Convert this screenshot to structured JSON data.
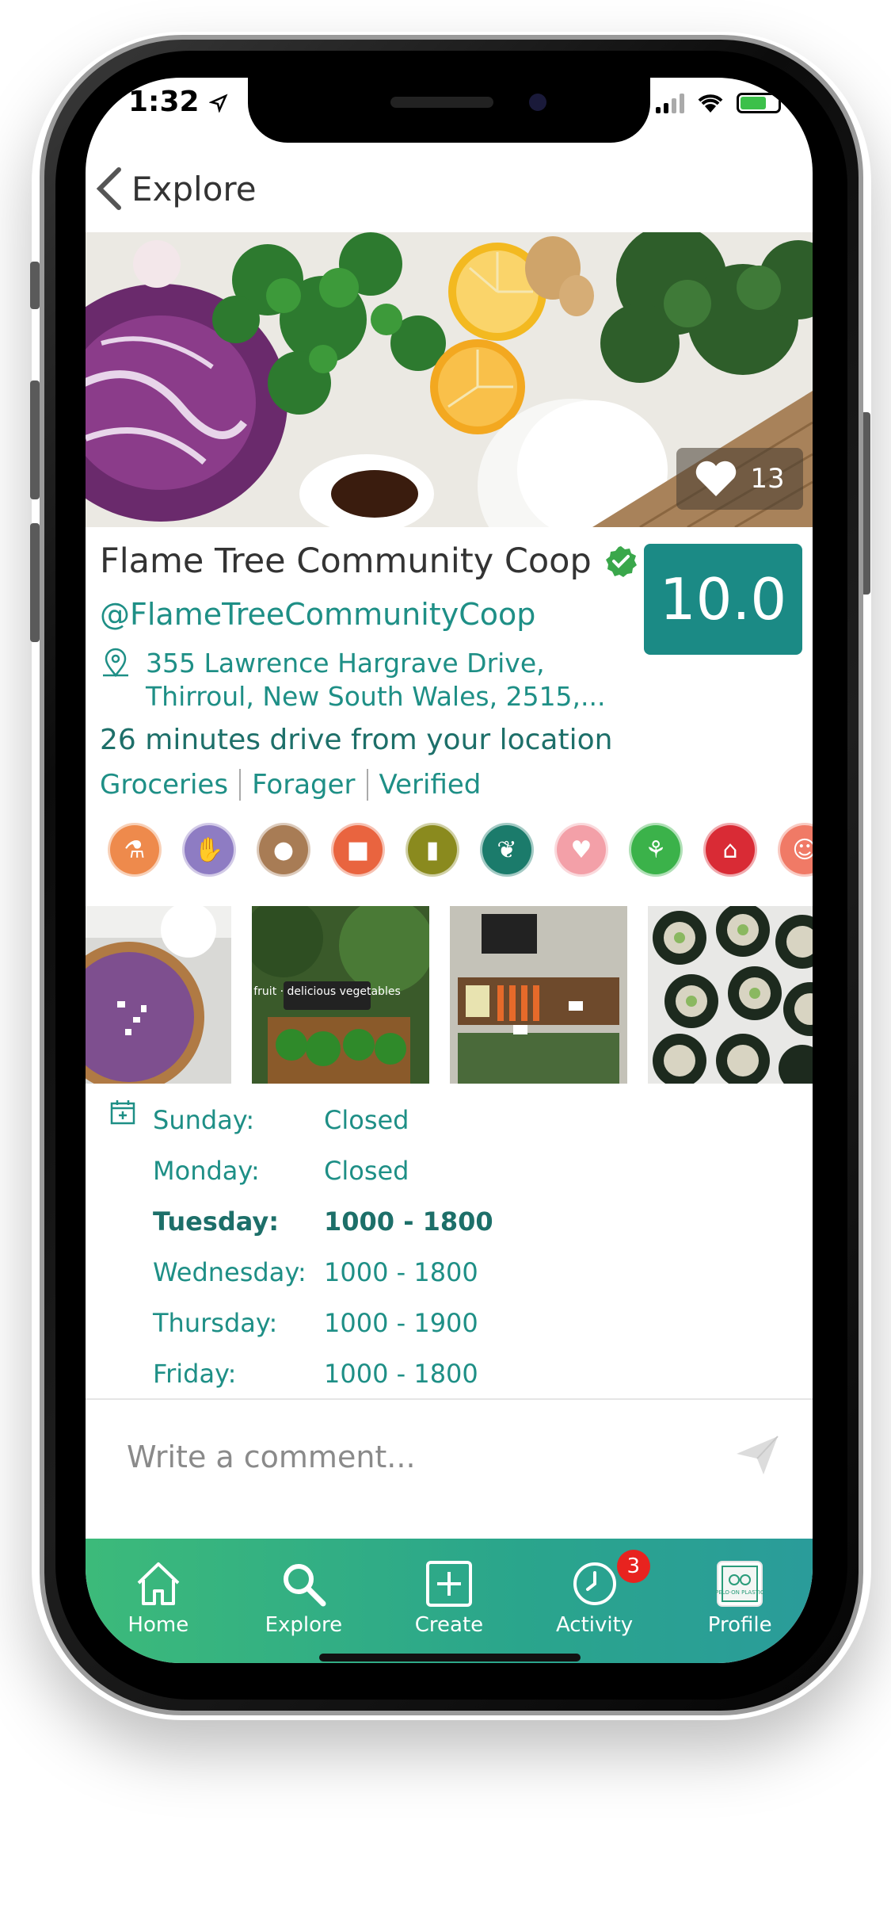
{
  "status_bar": {
    "time": "1:32"
  },
  "nav": {
    "back_label": "Explore"
  },
  "hero": {
    "like_count": "13"
  },
  "shop": {
    "name": "Flame Tree Community Coop",
    "handle": "@FlameTreeCommunityCoop",
    "address_line1": "355 Lawrence Hargrave Drive,",
    "address_line2": "Thirroul, New South Wales, 2515,...",
    "drive_time": "26 minutes drive from your location",
    "score": "10.0",
    "tags": [
      "Groceries",
      "Forager",
      "Verified"
    ]
  },
  "categories": [
    {
      "icon": "flask-icon",
      "color": "#ee8a4c"
    },
    {
      "icon": "handshake-icon",
      "color": "#8e7cc3"
    },
    {
      "icon": "cow-icon",
      "color": "#a87c55"
    },
    {
      "icon": "bread-icon",
      "color": "#e9643f"
    },
    {
      "icon": "jar-icon",
      "color": "#8a8a1e"
    },
    {
      "icon": "produce-icon",
      "color": "#1b7b6b"
    },
    {
      "icon": "heart-hand-icon",
      "color": "#f3a0a8"
    },
    {
      "icon": "vegetables-icon",
      "color": "#3bb24a"
    },
    {
      "icon": "barn-icon",
      "color": "#d92b35"
    },
    {
      "icon": "chef-icon",
      "color": "#f07a66"
    }
  ],
  "hours": [
    {
      "day": "Sunday:",
      "time": "Closed"
    },
    {
      "day": "Monday:",
      "time": "Closed"
    },
    {
      "day": "Tuesday:",
      "time": "1000 - 1800"
    },
    {
      "day": "Wednesday:",
      "time": "1000 - 1800"
    },
    {
      "day": "Thursday:",
      "time": "1000 - 1900"
    },
    {
      "day": "Friday:",
      "time": "1000 - 1800"
    }
  ],
  "comment": {
    "placeholder": "Write a comment..."
  },
  "tabbar": {
    "home": "Home",
    "explore": "Explore",
    "create": "Create",
    "activity": "Activity",
    "activity_badge": "3",
    "profile": "Profile"
  },
  "photos": {
    "fruit_sign": "fruit · delicious vegetables",
    "profile_logo_text": "PELO·ON PLASTIC"
  }
}
